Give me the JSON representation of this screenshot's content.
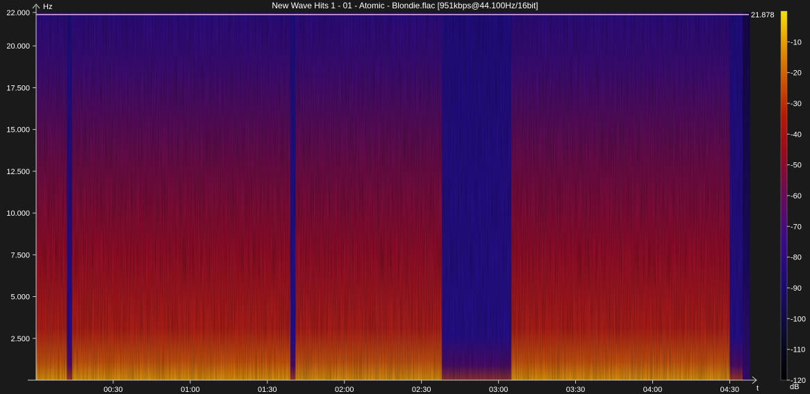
{
  "chart_data": {
    "type": "heatmap",
    "title": "New Wave Hits 1 - 01 - Atomic - Blondie.flac [951kbps@44.100Hz/16bit]",
    "ylabel": "Hz",
    "xlabel": "t",
    "ylim": [
      0,
      22000
    ],
    "xlim_seconds": [
      0,
      278
    ],
    "y_ticks": [
      "2.500",
      "5.000",
      "7.500",
      "10.000",
      "12.500",
      "15.000",
      "17.500",
      "20.000",
      "22.000"
    ],
    "y_tick_values": [
      2500,
      5000,
      7500,
      10000,
      12500,
      15000,
      17500,
      20000,
      22000
    ],
    "x_ticks": [
      "00:30",
      "01:00",
      "01:30",
      "02:00",
      "02:30",
      "03:00",
      "03:30",
      "04:00",
      "04:30"
    ],
    "x_tick_seconds": [
      30,
      60,
      90,
      120,
      150,
      180,
      210,
      240,
      270
    ],
    "cutoff_label": "21.878",
    "cutoff_hz": 21878,
    "colorbar": {
      "label": "dB",
      "ticks": [
        "-10",
        "-20",
        "-30",
        "-40",
        "-50",
        "-60",
        "-70",
        "-80",
        "-90",
        "-100",
        "-110",
        "-120"
      ],
      "tick_values": [
        -10,
        -20,
        -30,
        -40,
        -50,
        -60,
        -70,
        -80,
        -90,
        -100,
        -110,
        -120
      ],
      "range": [
        -120,
        0
      ]
    },
    "energy_segments": [
      {
        "start_s": 0,
        "end_s": 12,
        "level": 0.78
      },
      {
        "start_s": 12,
        "end_s": 14,
        "level": 0.42
      },
      {
        "start_s": 14,
        "end_s": 99,
        "level": 0.78
      },
      {
        "start_s": 99,
        "end_s": 101,
        "level": 0.48
      },
      {
        "start_s": 101,
        "end_s": 158,
        "level": 0.74
      },
      {
        "start_s": 158,
        "end_s": 185,
        "level": 0.22
      },
      {
        "start_s": 185,
        "end_s": 270,
        "level": 0.76
      },
      {
        "start_s": 270,
        "end_s": 275,
        "level": 0.35
      },
      {
        "start_s": 275,
        "end_s": 278,
        "level": 0.08
      }
    ]
  }
}
